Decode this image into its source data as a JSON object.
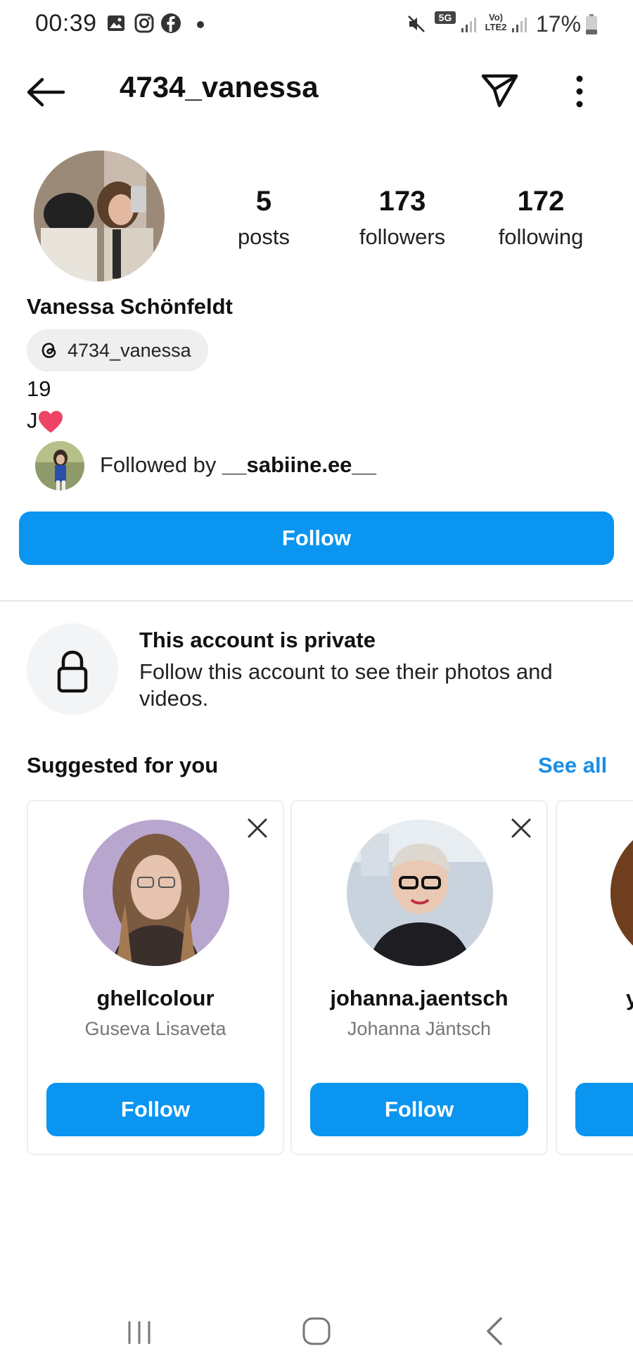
{
  "status_bar": {
    "time": "00:39",
    "network": "5G",
    "carrier": "Vo) LTE2",
    "battery": "17%",
    "icons": [
      "gallery-icon",
      "instagram-icon",
      "facebook-icon",
      "mute-icon",
      "signal-icon",
      "battery-icon"
    ]
  },
  "header": {
    "username": "4734_vanessa",
    "back_icon": "back-arrow-icon",
    "send_icon": "send-message-icon",
    "more_icon": "more-vertical-icon"
  },
  "profile": {
    "stats": [
      {
        "value": "5",
        "label": "posts"
      },
      {
        "value": "173",
        "label": "followers"
      },
      {
        "value": "172",
        "label": "following"
      }
    ],
    "full_name": "Vanessa Schönfeldt",
    "threads_handle": "4734_vanessa",
    "bio_line1": "19",
    "bio_line2": "J",
    "followed_by_prefix": "Followed by ",
    "followed_by_user": "__sabiine.ee__",
    "follow_label": "Follow"
  },
  "private_notice": {
    "title": "This account is private",
    "description": "Follow this account to see their photos and videos."
  },
  "suggested": {
    "title": "Suggested for you",
    "see_all": "See all",
    "cards": [
      {
        "username": "ghellcolour",
        "name": "Guseva Lisaveta",
        "follow_label": "Follow"
      },
      {
        "username": "johanna.jaentsch",
        "name": "Johanna Jäntsch",
        "follow_label": "Follow"
      }
    ],
    "partial_card_initial": "y"
  },
  "colors": {
    "accent": "#0a95f0",
    "link": "#1a8ee6",
    "heart": "#ee4466"
  }
}
